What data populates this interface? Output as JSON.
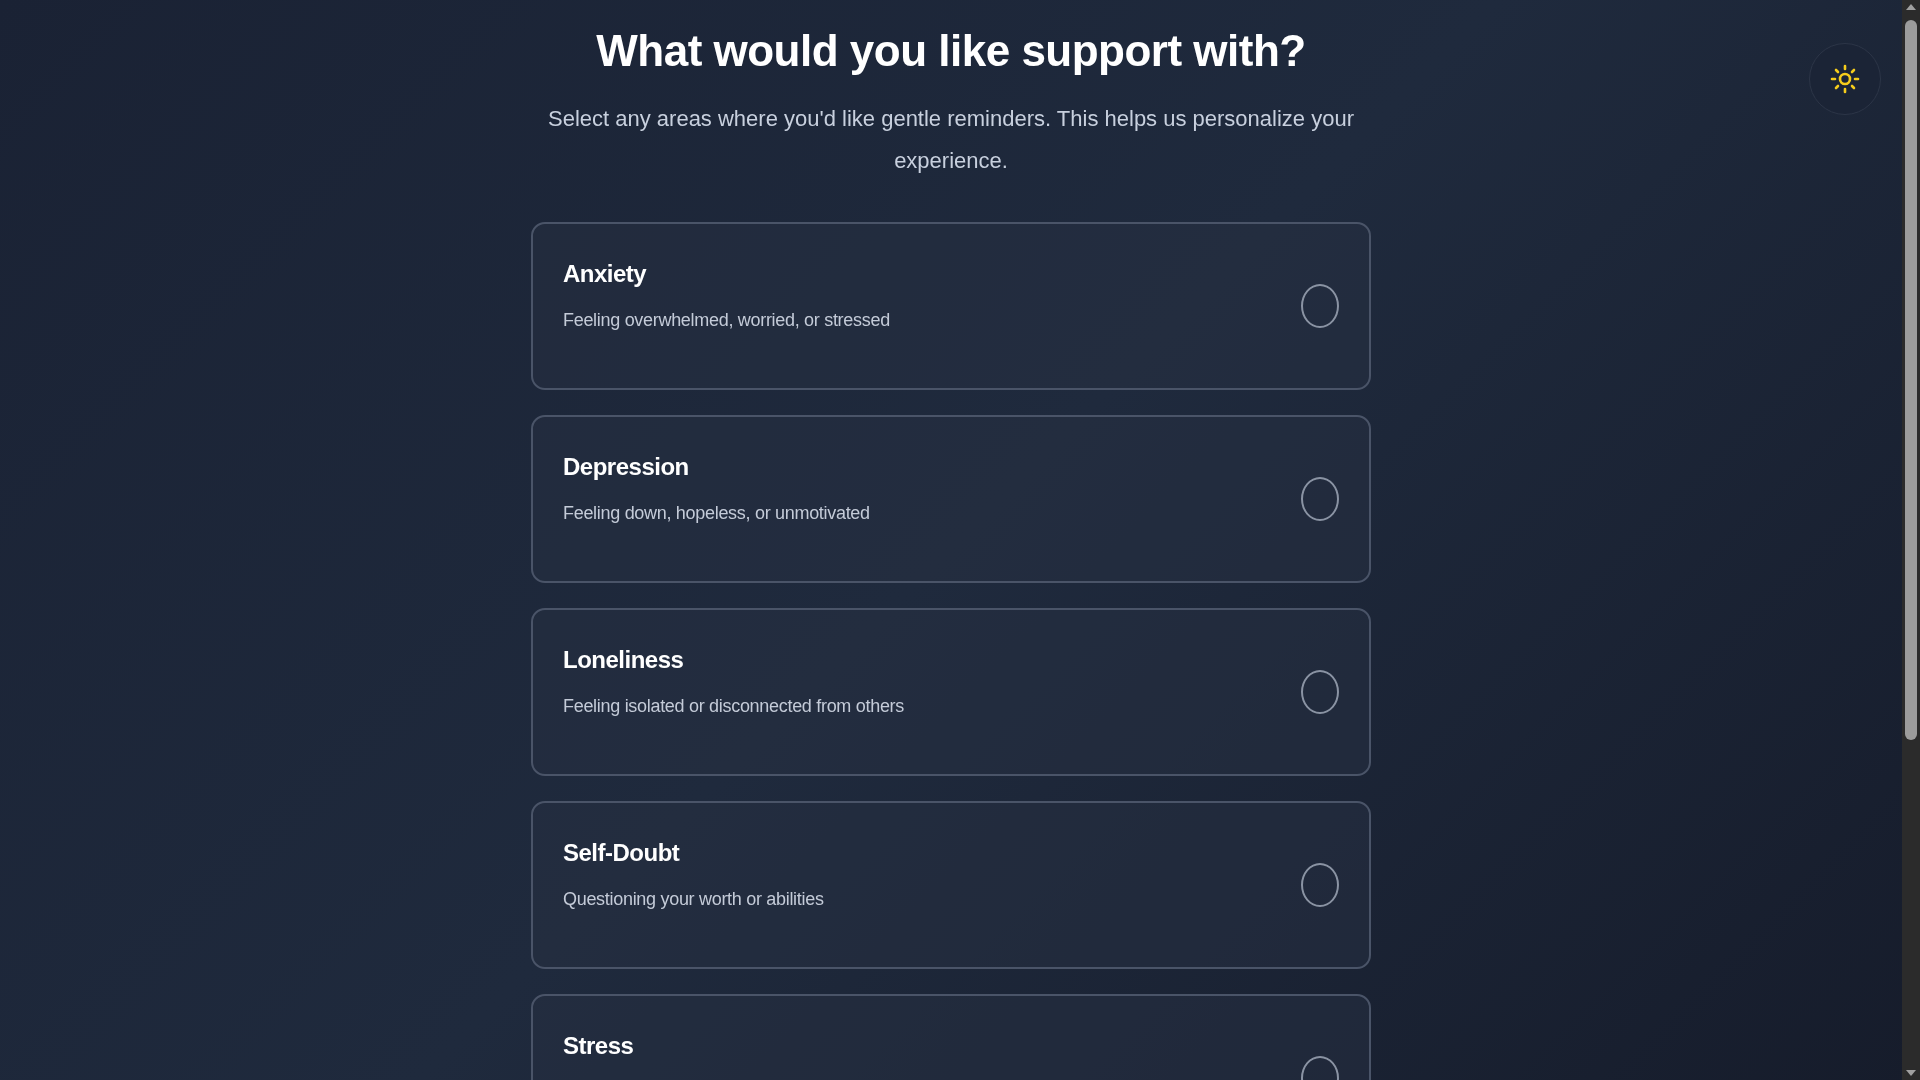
{
  "heading": "What would you like support with?",
  "subtitle": "Select any areas where you'd like gentle reminders. This helps us personalize your experience.",
  "options": [
    {
      "title": "Anxiety",
      "description": "Feeling overwhelmed, worried, or stressed",
      "selected": false
    },
    {
      "title": "Depression",
      "description": "Feeling down, hopeless, or unmotivated",
      "selected": false
    },
    {
      "title": "Loneliness",
      "description": "Feeling isolated or disconnected from others",
      "selected": false
    },
    {
      "title": "Self-Doubt",
      "description": "Questioning your worth or abilities",
      "selected": false
    },
    {
      "title": "Stress",
      "selected": false
    }
  ]
}
